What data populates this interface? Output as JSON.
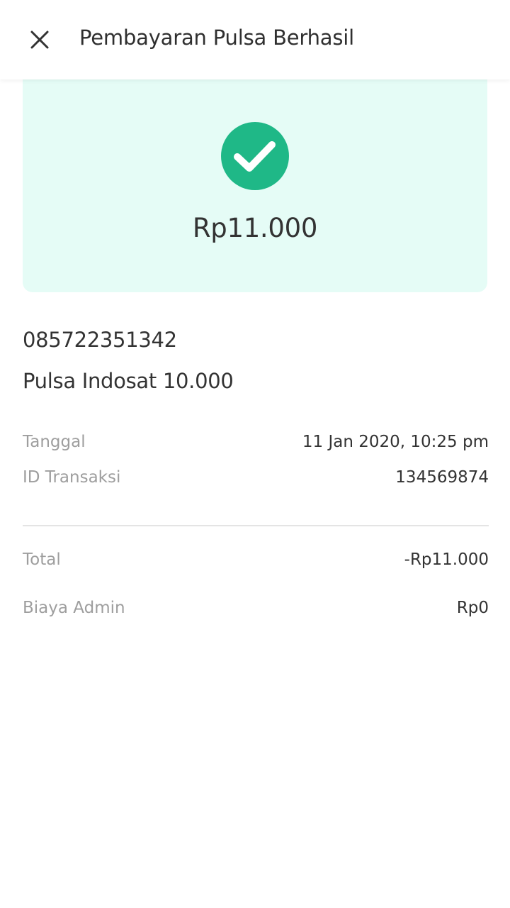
{
  "header": {
    "title": "Pembayaran Pulsa Berhasil",
    "close_icon": "close-icon"
  },
  "success": {
    "icon": "check-circle-icon",
    "amount": "Rp11.000",
    "colors": {
      "card_background": "#e5fcf6",
      "check": "#1fb887"
    }
  },
  "details": {
    "phone_number": "085722351342",
    "product": "Pulsa Indosat 10.000",
    "date_label": "Tanggal",
    "date_value": "11 Jan 2020, 10:25 pm",
    "transaction_label": "ID Transaksi",
    "transaction_value": "134569874"
  },
  "summary": {
    "total_label": "Total",
    "total_value": "-Rp11.000",
    "admin_label": "Biaya Admin",
    "admin_value": "Rp0"
  }
}
